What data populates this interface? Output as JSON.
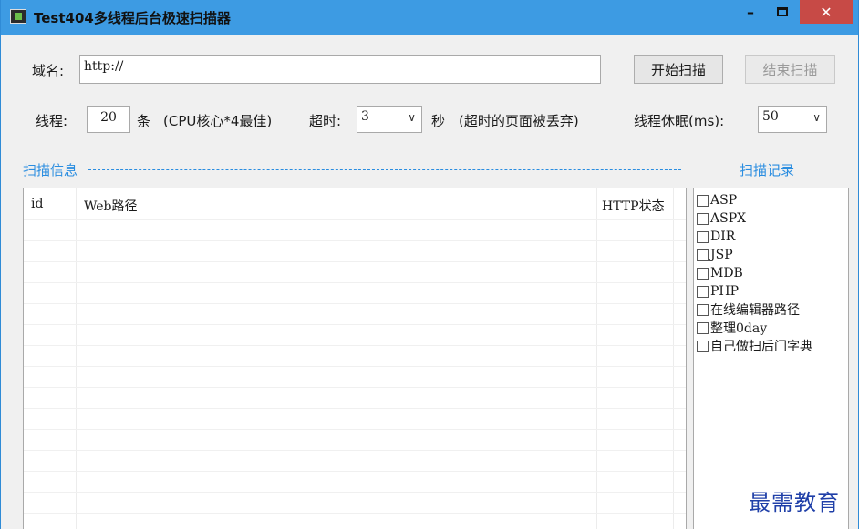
{
  "window": {
    "title": "Test404多线程后台极速扫描器",
    "minimize": "–",
    "close": "✕"
  },
  "domain": {
    "label": "域名:",
    "value": "http://"
  },
  "buttons": {
    "start": "开始扫描",
    "stop": "结束扫描"
  },
  "threads": {
    "label": "线程:",
    "value": "20",
    "unit": "条",
    "hint": "(CPU核心*4最佳)"
  },
  "timeout": {
    "label": "超时:",
    "value": "3",
    "unit": "秒",
    "hint": "(超时的页面被丢弃)"
  },
  "sleep": {
    "label": "线程休眠(ms):",
    "value": "50"
  },
  "scan_info": {
    "title": "扫描信息",
    "columns": [
      "id",
      "Web路径",
      "HTTP状态"
    ]
  },
  "scan_records": {
    "title": "扫描记录",
    "items": [
      "ASP",
      "ASPX",
      "DIR",
      "JSP",
      "MDB",
      "PHP",
      "在线编辑器路径",
      "整理0day",
      "自己做扫后门字典"
    ]
  },
  "watermark": "最需教育"
}
